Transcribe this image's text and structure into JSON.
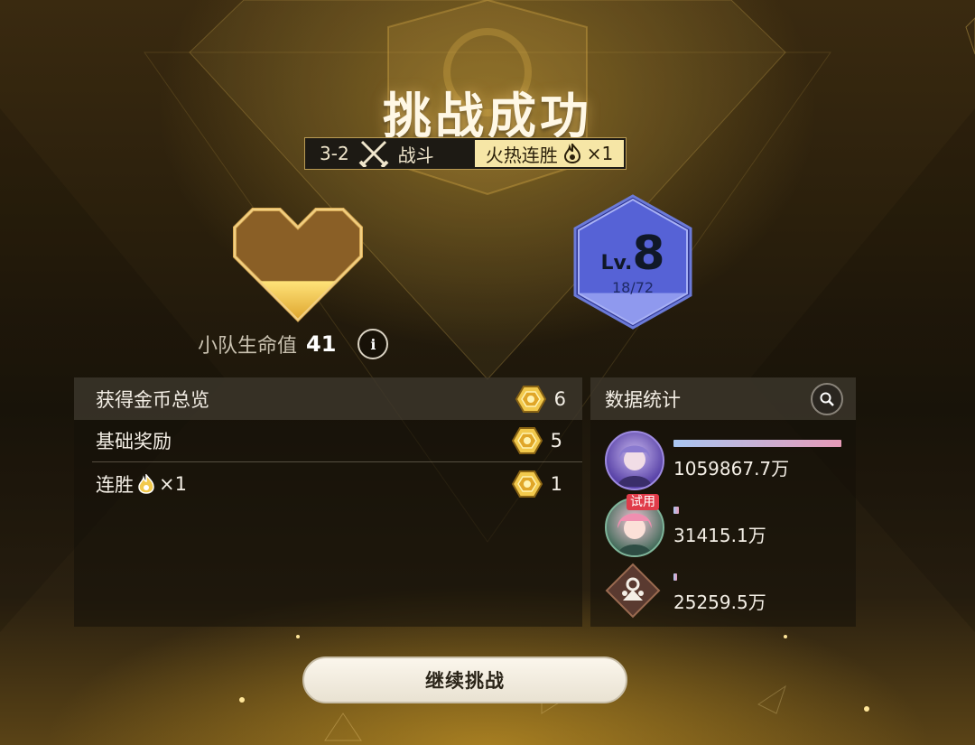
{
  "result_title": "挑战成功",
  "stage": {
    "code": "3-2",
    "type_label": "战斗",
    "streak_label": "火热连胜",
    "streak_count": "×1"
  },
  "team_hp": {
    "label": "小队生命值",
    "value": "41",
    "fill_fraction": 0.35,
    "info_icon": "i"
  },
  "level": {
    "prefix": "Lv.",
    "value": "8",
    "progress": "18/72",
    "progress_fraction": 0.25
  },
  "coins_panel": {
    "header": "获得金币总览",
    "total": "6",
    "rows": [
      {
        "label": "基础奖励",
        "value": "5"
      },
      {
        "label": "连胜",
        "suffix": "×1",
        "value": "1"
      }
    ]
  },
  "stats_panel": {
    "header": "数据统计",
    "entries": [
      {
        "value": "1059867.7万",
        "fraction": 1.0,
        "trial": ""
      },
      {
        "value": "31415.1万",
        "fraction": 0.03,
        "trial": "试用"
      },
      {
        "value": "25259.5万",
        "fraction": 0.024,
        "trial": ""
      }
    ]
  },
  "continue_button": "继续挑战",
  "colors": {
    "gold": "#f2c94c",
    "bar_gradient_start": "#a9c6f2",
    "bar_gradient_end": "#e79bb8",
    "level_blue": "#4350c8",
    "trial_red": "#e03c4a"
  }
}
